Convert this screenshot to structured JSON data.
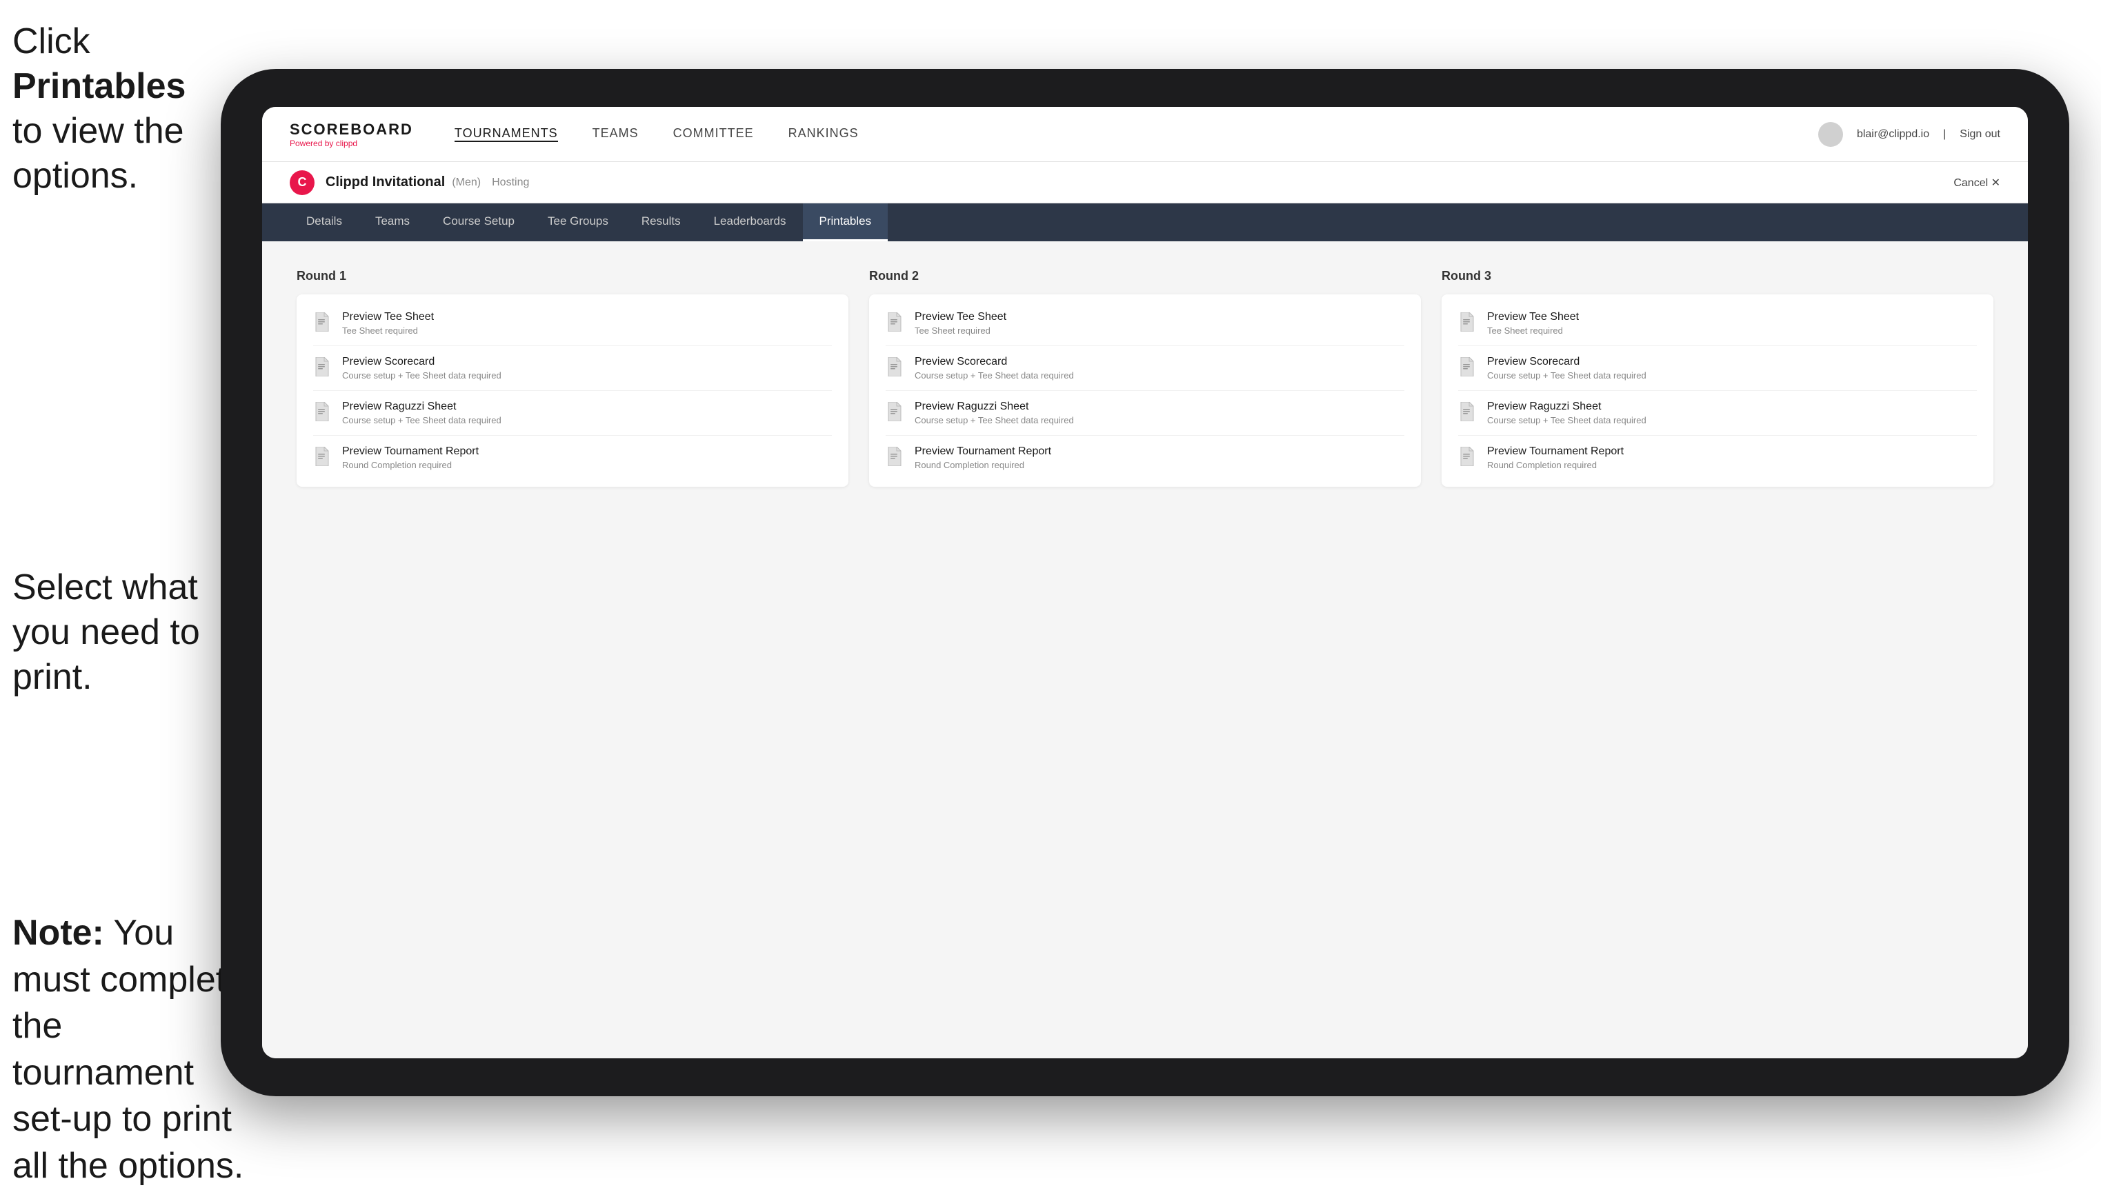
{
  "instructions": {
    "top_text_1": "Click ",
    "top_bold": "Printables",
    "top_text_2": " to view the options.",
    "middle_text": "Select what you need to print.",
    "bottom_bold": "Note:",
    "bottom_text": " You must complete the tournament set-up to print all the options."
  },
  "nav": {
    "brand_title": "SCOREBOARD",
    "brand_subtitle": "Powered by clippd",
    "links": [
      "TOURNAMENTS",
      "TEAMS",
      "COMMITTEE",
      "RANKINGS"
    ],
    "user_email": "blair@clippd.io",
    "sign_out": "Sign out"
  },
  "tournament": {
    "logo_letter": "C",
    "name": "Clippd Invitational",
    "type": "(Men)",
    "status": "Hosting",
    "cancel": "Cancel ✕"
  },
  "sub_tabs": [
    "Details",
    "Teams",
    "Course Setup",
    "Tee Groups",
    "Results",
    "Leaderboards",
    "Printables"
  ],
  "active_tab": "Printables",
  "rounds": [
    {
      "title": "Round 1",
      "items": [
        {
          "name": "Preview Tee Sheet",
          "desc": "Tee Sheet required"
        },
        {
          "name": "Preview Scorecard",
          "desc": "Course setup + Tee Sheet data required"
        },
        {
          "name": "Preview Raguzzi Sheet",
          "desc": "Course setup + Tee Sheet data required"
        },
        {
          "name": "Preview Tournament Report",
          "desc": "Round Completion required"
        }
      ]
    },
    {
      "title": "Round 2",
      "items": [
        {
          "name": "Preview Tee Sheet",
          "desc": "Tee Sheet required"
        },
        {
          "name": "Preview Scorecard",
          "desc": "Course setup + Tee Sheet data required"
        },
        {
          "name": "Preview Raguzzi Sheet",
          "desc": "Course setup + Tee Sheet data required"
        },
        {
          "name": "Preview Tournament Report",
          "desc": "Round Completion required"
        }
      ]
    },
    {
      "title": "Round 3",
      "items": [
        {
          "name": "Preview Tee Sheet",
          "desc": "Tee Sheet required"
        },
        {
          "name": "Preview Scorecard",
          "desc": "Course setup + Tee Sheet data required"
        },
        {
          "name": "Preview Raguzzi Sheet",
          "desc": "Course setup + Tee Sheet data required"
        },
        {
          "name": "Preview Tournament Report",
          "desc": "Round Completion required"
        }
      ]
    }
  ],
  "colors": {
    "accent": "#e8174b",
    "nav_bg": "#2d3748",
    "active_tab_bg": "#3a4a62"
  }
}
